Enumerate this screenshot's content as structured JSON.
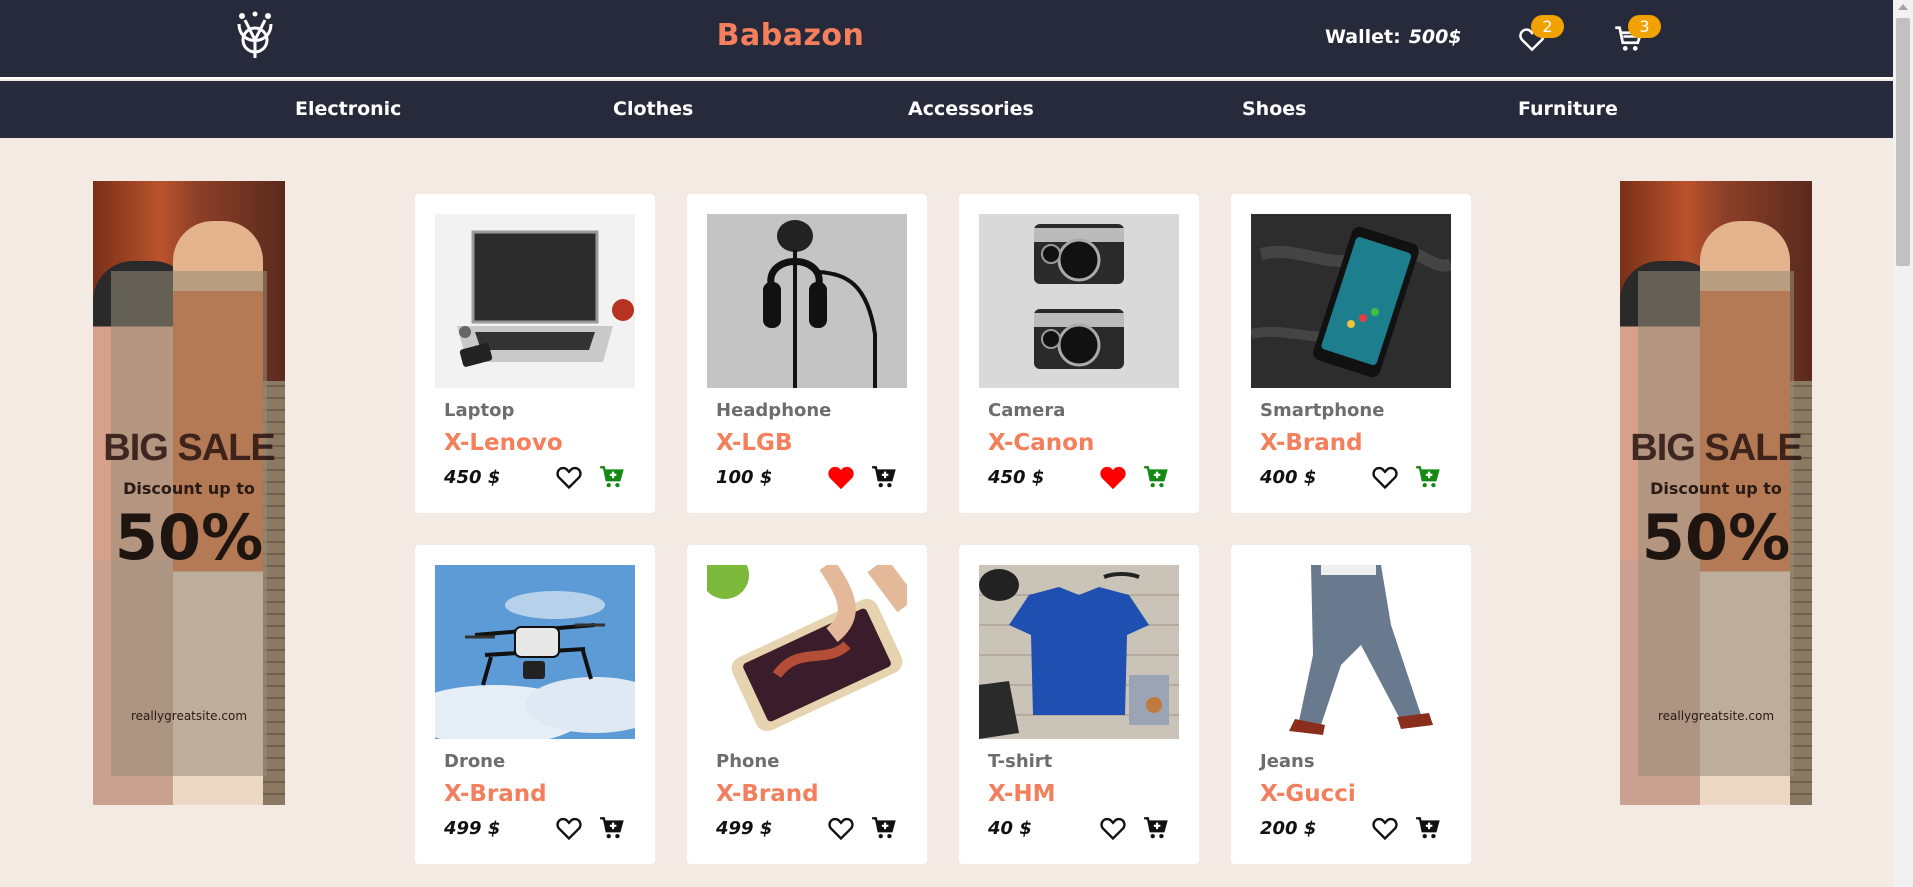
{
  "header": {
    "brand": "Babazon",
    "wallet_label": "Wallet:",
    "wallet_amount": "500$",
    "favorites_count": "2",
    "cart_count": "3"
  },
  "nav": {
    "items": [
      {
        "label": "Electronic"
      },
      {
        "label": "Clothes"
      },
      {
        "label": "Accessories"
      },
      {
        "label": "Shoes"
      },
      {
        "label": "Furniture"
      }
    ]
  },
  "banner": {
    "title": "BIG SALE",
    "subtitle": "Discount up to",
    "percent": "50%",
    "site": "reallygreatsite.com"
  },
  "products": [
    {
      "category": "Laptop",
      "name": "X-Lenovo",
      "price": "450 $",
      "liked": false,
      "in_cart": true
    },
    {
      "category": "Headphone",
      "name": "X-LGB",
      "price": "100 $",
      "liked": true,
      "in_cart": false
    },
    {
      "category": "Camera",
      "name": "X-Canon",
      "price": "450 $",
      "liked": true,
      "in_cart": true
    },
    {
      "category": "Smartphone",
      "name": "X-Brand",
      "price": "400 $",
      "liked": false,
      "in_cart": true
    },
    {
      "category": "Drone",
      "name": "X-Brand",
      "price": "499 $",
      "liked": false,
      "in_cart": false
    },
    {
      "category": "Phone",
      "name": "X-Brand",
      "price": "499 $",
      "liked": false,
      "in_cart": false
    },
    {
      "category": "T-shirt",
      "name": "X-HM",
      "price": "40 $",
      "liked": false,
      "in_cart": false
    },
    {
      "category": "Jeans",
      "name": "X-Gucci",
      "price": "200 $",
      "liked": false,
      "in_cart": false
    }
  ],
  "colors": {
    "header_bg": "#272a3a",
    "accent": "#f37f5c",
    "badge": "#f2a200",
    "page_bg": "#f3ebe3",
    "liked": "#ff0000",
    "in_cart": "#138a13"
  }
}
